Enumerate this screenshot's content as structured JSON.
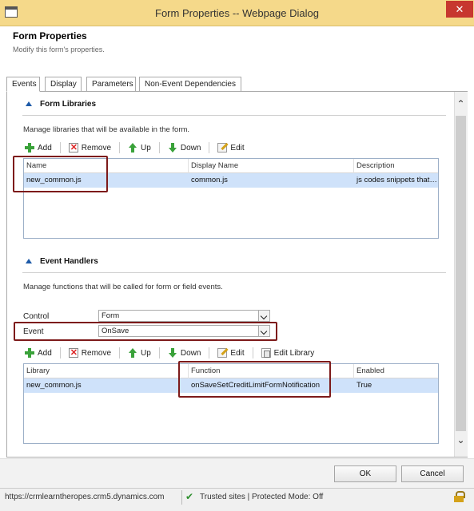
{
  "window": {
    "title": "Form Properties -- Webpage Dialog",
    "close_glyph": "✕"
  },
  "header": {
    "title": "Form Properties",
    "subtitle": "Modify this form's properties."
  },
  "tabs": [
    {
      "label": "Events",
      "active": true
    },
    {
      "label": "Display",
      "active": false
    },
    {
      "label": "Parameters",
      "active": false
    },
    {
      "label": "Non-Event Dependencies",
      "active": false
    }
  ],
  "form_libraries": {
    "heading": "Form Libraries",
    "description": "Manage libraries that will be available in the form.",
    "toolbar": {
      "add": "Add",
      "remove": "Remove",
      "up": "Up",
      "down": "Down",
      "edit": "Edit"
    },
    "columns": [
      "Name",
      "Display Name",
      "Description"
    ],
    "rows": [
      {
        "name": "new_common.js",
        "display_name": "common.js",
        "description": "js codes snippets that…"
      }
    ]
  },
  "event_handlers": {
    "heading": "Event Handlers",
    "description": "Manage functions that will be called for form or field events.",
    "control_label": "Control",
    "control_value": "Form",
    "event_label": "Event",
    "event_value": "OnSave",
    "toolbar": {
      "add": "Add",
      "remove": "Remove",
      "up": "Up",
      "down": "Down",
      "edit": "Edit",
      "edit_library": "Edit Library"
    },
    "columns": [
      "Library",
      "Function",
      "Enabled"
    ],
    "rows": [
      {
        "library": "new_common.js",
        "function": "onSaveSetCreditLimitFormNotification",
        "enabled": "True"
      }
    ]
  },
  "footer": {
    "ok": "OK",
    "cancel": "Cancel"
  },
  "statusbar": {
    "url": "https://crmlearntheropes.crm5.dynamics.com",
    "zone": "Trusted sites | Protected Mode: Off"
  },
  "colors": {
    "titlebar": "#f5d98a",
    "selected_row": "#cfe2fa",
    "highlight_box": "#7d1a1a",
    "close_button": "#c7372f"
  }
}
